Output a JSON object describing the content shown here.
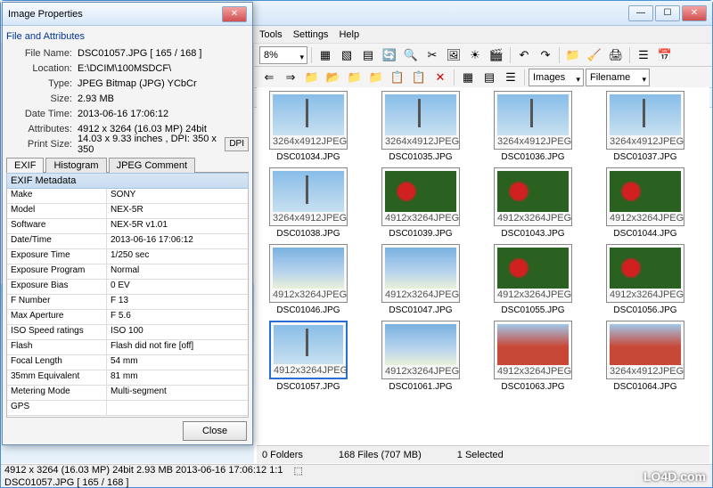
{
  "bg": {
    "menus": [
      "Tools",
      "Settings",
      "Help"
    ],
    "zoom": "8%",
    "view_sel": "Images",
    "sort_sel": "Filename",
    "path": "E:\\DCIM\\100MSDCF\\",
    "status": {
      "folders": "0 Folders",
      "files": "168 Files (707 MB)",
      "sel": "1 Selected"
    }
  },
  "thumbs": [
    [
      {
        "dim": "3264x4912",
        "fmt": "JPEG",
        "name": "DSC01034.JPG",
        "t": "tower"
      },
      {
        "dim": "3264x4912",
        "fmt": "JPEG",
        "name": "DSC01035.JPG",
        "t": "tower"
      },
      {
        "dim": "3264x4912",
        "fmt": "JPEG",
        "name": "DSC01036.JPG",
        "t": "tower"
      },
      {
        "dim": "3264x4912",
        "fmt": "JPEG",
        "name": "DSC01037.JPG",
        "t": "tower"
      }
    ],
    [
      {
        "dim": "3264x4912",
        "fmt": "JPEG",
        "name": "DSC01038.JPG",
        "t": "tower"
      },
      {
        "dim": "4912x3264",
        "fmt": "JPEG",
        "name": "DSC01039.JPG",
        "t": "flowers"
      },
      {
        "dim": "4912x3264",
        "fmt": "JPEG",
        "name": "DSC01043.JPG",
        "t": "flowers"
      },
      {
        "dim": "4912x3264",
        "fmt": "JPEG",
        "name": "DSC01044.JPG",
        "t": "flowers"
      }
    ],
    [
      {
        "dim": "4912x3264",
        "fmt": "JPEG",
        "name": "DSC01046.JPG",
        "t": ""
      },
      {
        "dim": "4912x3264",
        "fmt": "JPEG",
        "name": "DSC01047.JPG",
        "t": ""
      },
      {
        "dim": "4912x3264",
        "fmt": "JPEG",
        "name": "DSC01055.JPG",
        "t": "flowers"
      },
      {
        "dim": "4912x3264",
        "fmt": "JPEG",
        "name": "DSC01056.JPG",
        "t": "flowers"
      }
    ],
    [
      {
        "dim": "4912x3264",
        "fmt": "JPEG",
        "name": "DSC01057.JPG",
        "t": "tower",
        "sel": true
      },
      {
        "dim": "4912x3264",
        "fmt": "JPEG",
        "name": "DSC01061.JPG",
        "t": ""
      },
      {
        "dim": "4912x3264",
        "fmt": "JPEG",
        "name": "DSC01063.JPG",
        "t": "building"
      },
      {
        "dim": "3264x4912",
        "fmt": "JPEG",
        "name": "DSC01064.JPG",
        "t": "building"
      }
    ]
  ],
  "bstatus": {
    "line1": "4912 x 3264 (16.03 MP)    24bit    2.93 MB    2013-06-16 17:06:12    1:1",
    "line2": "DSC01057.JPG   [ 165 / 168 ]"
  },
  "dlg": {
    "title": "Image Properties",
    "group": "File and Attributes",
    "attrs": [
      {
        "k": "File Name:",
        "v": "DSC01057.JPG   [ 165 / 168 ]"
      },
      {
        "k": "Location:",
        "v": "E:\\DCIM\\100MSDCF\\"
      },
      {
        "k": "Type:",
        "v": "JPEG Bitmap (JPG) YCbCr"
      },
      {
        "k": "Size:",
        "v": "2.93 MB"
      },
      {
        "k": "Date Time:",
        "v": "2013-06-16 17:06:12"
      },
      {
        "k": "Attributes:",
        "v": "4912 x 3264 (16.03 MP)  24bit"
      },
      {
        "k": "Print Size:",
        "v": "14.03 x 9.33 inches ,   DPI: 350 x 350"
      }
    ],
    "dpi_btn": "DPI",
    "tabs": [
      "EXIF",
      "Histogram",
      "JPEG Comment"
    ],
    "exif_title": "EXIF Metadata",
    "exif": [
      {
        "k": "Make",
        "v": "SONY"
      },
      {
        "k": "Model",
        "v": "NEX-5R"
      },
      {
        "k": "Software",
        "v": "NEX-5R v1.01"
      },
      {
        "k": "Date/Time",
        "v": "2013-06-16 17:06:12"
      },
      {
        "k": "Exposure Time",
        "v": "1/250 sec"
      },
      {
        "k": "Exposure Program",
        "v": "Normal"
      },
      {
        "k": "Exposure Bias",
        "v": "0 EV"
      },
      {
        "k": "F Number",
        "v": "F 13"
      },
      {
        "k": "Max Aperture",
        "v": "F 5.6"
      },
      {
        "k": "ISO Speed ratings",
        "v": "ISO 100"
      },
      {
        "k": "Flash",
        "v": "Flash did not fire [off]"
      },
      {
        "k": "Focal Length",
        "v": "54 mm"
      },
      {
        "k": "35mm Equivalent",
        "v": "81 mm"
      },
      {
        "k": "Metering Mode",
        "v": "Multi-segment"
      },
      {
        "k": "GPS",
        "v": ""
      }
    ],
    "close": "Close"
  },
  "watermark": "LO4D.com"
}
